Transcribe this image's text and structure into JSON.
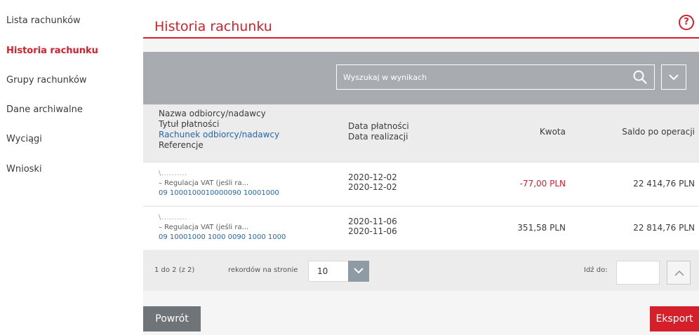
{
  "sidebar": {
    "items": [
      {
        "label": "Lista rachunków"
      },
      {
        "label": "Historia rachunku"
      },
      {
        "label": "Grupy rachunków"
      },
      {
        "label": "Dane archiwalne"
      },
      {
        "label": "Wyciągi"
      },
      {
        "label": "Wnioski"
      }
    ],
    "active_index": 1
  },
  "header": {
    "title": "Historia rachunku",
    "help_label": "?"
  },
  "search": {
    "placeholder": "Wyszukaj w wynikach",
    "value": ""
  },
  "table": {
    "headers": {
      "col1": [
        "Nazwa odbiorcy/nadawcy",
        "Tytuł płatności",
        "Rachunek odbiorcy/nadawcy",
        "Referencje"
      ],
      "col2": [
        "Data płatności",
        "Data realizacji"
      ],
      "col3": "Kwota",
      "col4": "Saldo po operacji"
    },
    "rows": [
      {
        "name": "\\..........",
        "title": "– Regulacja VAT (jeśli ra...",
        "account": "09 1000100010000090 10001000",
        "payment_date": "2020-12-02",
        "realization_date": "2020-12-02",
        "amount": "-77,00 PLN",
        "balance": "22 414,76 PLN"
      },
      {
        "name": "\\..........",
        "title": "– Regulacja VAT (jeśli ra...",
        "account": "09 10001000 1000 0090 1000 1000",
        "payment_date": "2020-11-06",
        "realization_date": "2020-11-06",
        "amount": "351,58 PLN",
        "balance": "22 814,76 PLN"
      }
    ]
  },
  "pager": {
    "count_text": "1 do 2 (z 2)",
    "per_page_label": "rekordów na stronie",
    "per_page_value": "10",
    "goto_label": "Idź do:",
    "goto_value": ""
  },
  "actions": {
    "back_label": "Powrót",
    "export_label": "Eksport"
  },
  "colors": {
    "accent": "#d5202b",
    "link": "#2466b3",
    "toolbar": "#a8acb0",
    "back_button": "#6f7479"
  }
}
